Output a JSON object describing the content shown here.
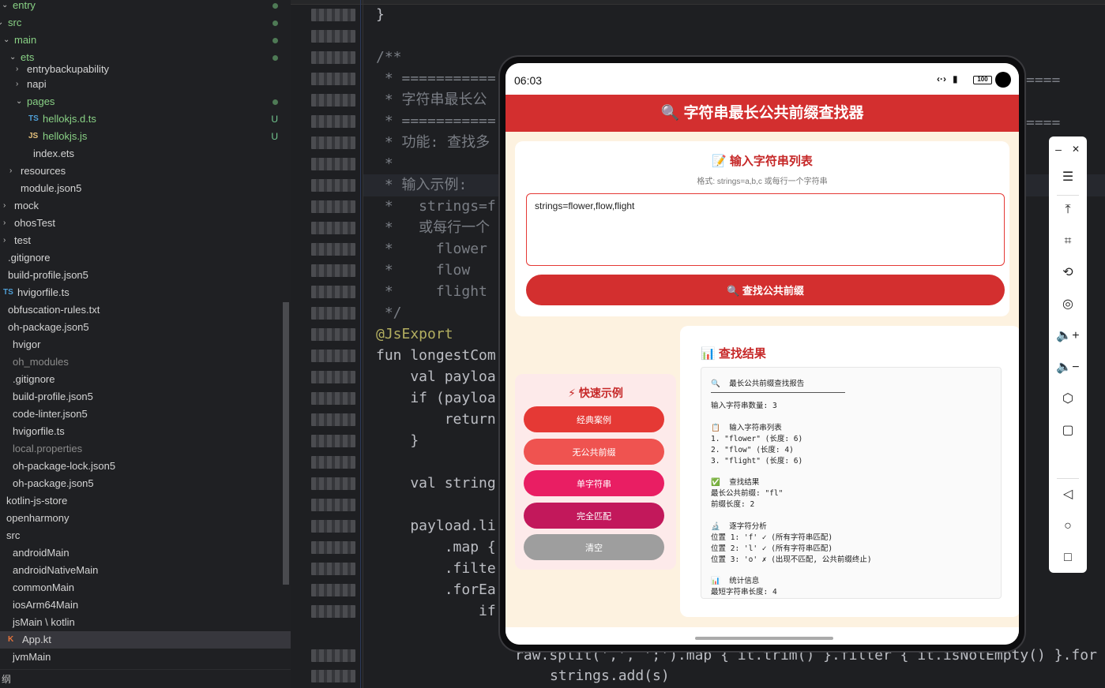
{
  "explorer": {
    "items": [
      {
        "label": "entry",
        "style": "green"
      },
      {
        "label": "src",
        "style": "green"
      },
      {
        "label": "main",
        "style": "green"
      },
      {
        "label": "ets",
        "style": "green"
      },
      {
        "label": "entrybackupability",
        "style": ""
      },
      {
        "label": "napi",
        "style": ""
      },
      {
        "label": "pages",
        "style": "green"
      },
      {
        "label": "hellokjs.d.ts",
        "style": "green",
        "badge": "U",
        "icon": "TS"
      },
      {
        "label": "hellokjs.js",
        "style": "green",
        "badge": "U",
        "icon": "JS"
      },
      {
        "label": "index.ets",
        "style": ""
      },
      {
        "label": "resources",
        "style": ""
      },
      {
        "label": "module.json5",
        "style": ""
      },
      {
        "label": "mock",
        "style": ""
      },
      {
        "label": "ohosTest",
        "style": ""
      },
      {
        "label": "test",
        "style": ""
      },
      {
        "label": ".gitignore",
        "style": ""
      },
      {
        "label": "build-profile.json5",
        "style": ""
      },
      {
        "label": "hvigorfile.ts",
        "style": "",
        "icon": "TS"
      },
      {
        "label": "obfuscation-rules.txt",
        "style": ""
      },
      {
        "label": "oh-package.json5",
        "style": ""
      },
      {
        "label": "hvigor",
        "style": ""
      },
      {
        "label": "oh_modules",
        "style": "dim"
      },
      {
        "label": ".gitignore",
        "style": ""
      },
      {
        "label": "build-profile.json5",
        "style": ""
      },
      {
        "label": "code-linter.json5",
        "style": ""
      },
      {
        "label": "hvigorfile.ts",
        "style": ""
      },
      {
        "label": "local.properties",
        "style": "dim"
      },
      {
        "label": "oh-package-lock.json5",
        "style": ""
      },
      {
        "label": "oh-package.json5",
        "style": ""
      },
      {
        "label": "kotlin-js-store",
        "style": ""
      },
      {
        "label": "openharmony",
        "style": ""
      },
      {
        "label": "src",
        "style": ""
      },
      {
        "label": "androidMain",
        "style": ""
      },
      {
        "label": "androidNativeMain",
        "style": ""
      },
      {
        "label": "commonMain",
        "style": ""
      },
      {
        "label": "iosArm64Main",
        "style": ""
      },
      {
        "label": "jsMain \\ kotlin",
        "style": ""
      },
      {
        "label": "App.kt",
        "style": "",
        "icon": "K"
      },
      {
        "label": "jvmMain",
        "style": ""
      }
    ],
    "footer": "纲"
  },
  "editor": {
    "lines": [
      {
        "text": "}",
        "kind": "code"
      },
      {
        "text": "",
        "kind": "code"
      },
      {
        "text": "/**",
        "kind": "comment"
      },
      {
        "text": " * ===========",
        "kind": "comment"
      },
      {
        "text": " * 字符串最长公",
        "kind": "comment"
      },
      {
        "text": " * ===========",
        "kind": "comment"
      },
      {
        "text": " * 功能: 查找多",
        "kind": "comment"
      },
      {
        "text": " *",
        "kind": "comment"
      },
      {
        "text": " * 输入示例:",
        "kind": "comment"
      },
      {
        "text": " *   strings=f",
        "kind": "comment"
      },
      {
        "text": " *   或每行一个",
        "kind": "comment"
      },
      {
        "text": " *     flower",
        "kind": "comment"
      },
      {
        "text": " *     flow",
        "kind": "comment"
      },
      {
        "text": " *     flight",
        "kind": "comment"
      },
      {
        "text": " */",
        "kind": "comment"
      },
      {
        "text": "@JsExport",
        "kind": "anno"
      },
      {
        "text": "fun longestCom",
        "kind": "code"
      },
      {
        "text": "    val payloa",
        "kind": "code"
      },
      {
        "text": "    if (payloa",
        "kind": "code"
      },
      {
        "text": "        return",
        "kind": "code"
      },
      {
        "text": "    }",
        "kind": "code"
      },
      {
        "text": "",
        "kind": "code"
      },
      {
        "text": "    val string",
        "kind": "code"
      },
      {
        "text": "",
        "kind": "code"
      },
      {
        "text": "    payload.li",
        "kind": "code"
      },
      {
        "text": "        .map {",
        "kind": "code"
      },
      {
        "text": "        .filte",
        "kind": "code"
      },
      {
        "text": "        .forEa",
        "kind": "code"
      },
      {
        "text": "            if",
        "kind": "code"
      }
    ],
    "overflow_line_1": "raw.split(',', ';').map { it.trim() }.filter { it.isNotEmpty() }.for",
    "overflow_line_2": "strings.add(s)",
    "right_fragments": [
      "====",
      "===="
    ]
  },
  "phone": {
    "status_time": "06:03",
    "battery": "100",
    "header_title": "🔍 字符串最长公共前缀查找器",
    "input_title": "📝 输入字符串列表",
    "input_hint": "格式: strings=a,b,c 或每行一个字符串",
    "input_value": "strings=flower,flow,flight",
    "find_button": "🔍 查找公共前缀",
    "examples_title": "⚡ 快速示例",
    "examples": [
      {
        "label": "经典案例",
        "color": "#e53935"
      },
      {
        "label": "无公共前缀",
        "color": "#ef5350"
      },
      {
        "label": "单字符串",
        "color": "#e91e63"
      },
      {
        "label": "完全匹配",
        "color": "#c2185b"
      },
      {
        "label": "清空",
        "color": "#9e9e9e"
      }
    ],
    "result_title": "📊 查找结果",
    "result_lines": [
      "🔍  最长公共前缀查找报告",
      "",
      "输入字符串数量: 3",
      "",
      "📋  输入字符串列表",
      "1. \"flower\" (长度: 6)",
      "2. \"flow\" (长度: 4)",
      "3. \"flight\" (长度: 6)",
      "",
      "✅  查找结果",
      "最长公共前缀: \"fl\"",
      "前缀长度: 2",
      "",
      "🔬  逐字符分析",
      "位置 1: 'f' ✓ (所有字符串匹配)",
      "位置 2: 'l' ✓ (所有字符串匹配)",
      "位置 3: 'o' ✗ (出现不匹配, 公共前缀终止)",
      "",
      "📊  统计信息",
      "最短字符串长度: 4"
    ]
  },
  "toolbar": {
    "minimize": "–",
    "close": "✕"
  },
  "colors": {
    "accent_red": "#d32f2f",
    "phone_bg": "#fdf2e0",
    "editor_bg": "#1e1f22"
  }
}
